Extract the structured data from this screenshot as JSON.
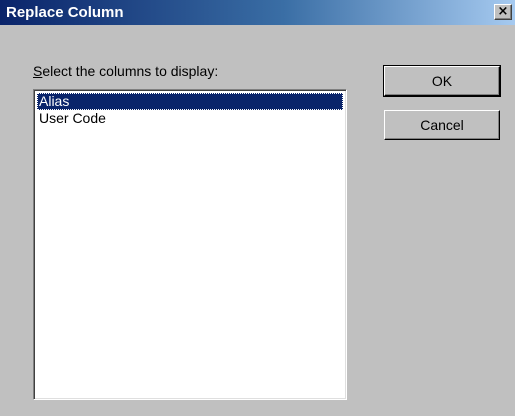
{
  "window": {
    "title": "Replace Column",
    "close_glyph": "×"
  },
  "main": {
    "label_prefix": "S",
    "label_rest": "elect the columns to display:",
    "columns": [
      {
        "label": "Alias",
        "selected": true
      },
      {
        "label": "User Code",
        "selected": false
      }
    ]
  },
  "buttons": {
    "ok_label": "OK",
    "cancel_label": "Cancel"
  },
  "colors": {
    "title_bar_start": "#0a246a",
    "title_bar_end": "#a6caf0",
    "face": "#c0c0c0",
    "selection": "#0a246a"
  },
  "icons": {
    "close": "close-icon"
  }
}
